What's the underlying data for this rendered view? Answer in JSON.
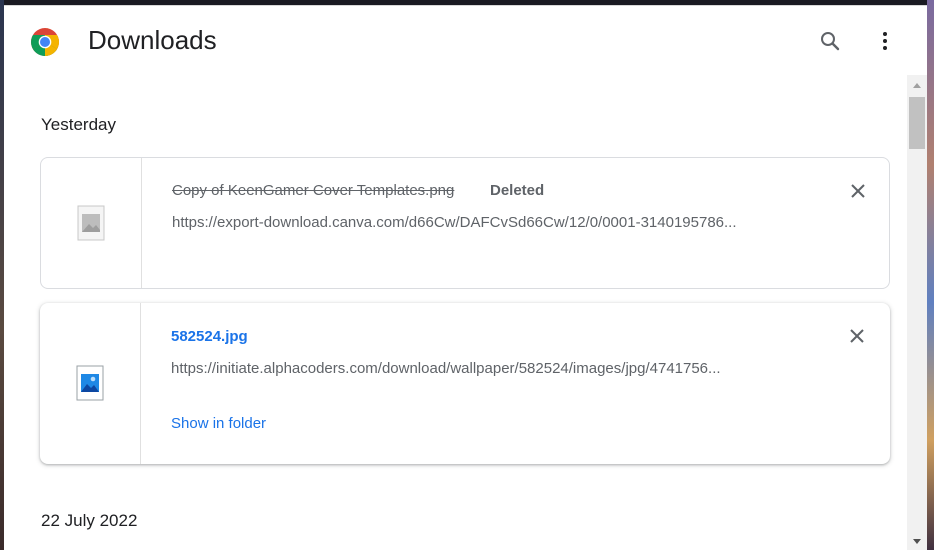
{
  "header": {
    "title": "Downloads",
    "logo_icon": "chrome-logo",
    "search_icon": "search-icon",
    "menu_icon": "more-vert-icon"
  },
  "sections": [
    {
      "label": "Yesterday",
      "items": [
        {
          "filename": "Copy of KeenGamer Cover Templates.png",
          "status": "Deleted",
          "url": "https://export-download.canva.com/d66Cw/DAFCvSd66Cw/12/0/0001-3140195786...",
          "icon": "broken-image-file-icon"
        },
        {
          "filename": "582524.jpg",
          "url": "https://initiate.alphacoders.com/download/wallpaper/582524/images/jpg/4741756...",
          "action": "Show in folder",
          "icon": "image-file-icon"
        }
      ]
    },
    {
      "label": "22 July 2022",
      "items": []
    }
  ],
  "colors": {
    "link": "#1a73e8",
    "text_secondary": "#5f6368",
    "text_primary": "#202124"
  }
}
